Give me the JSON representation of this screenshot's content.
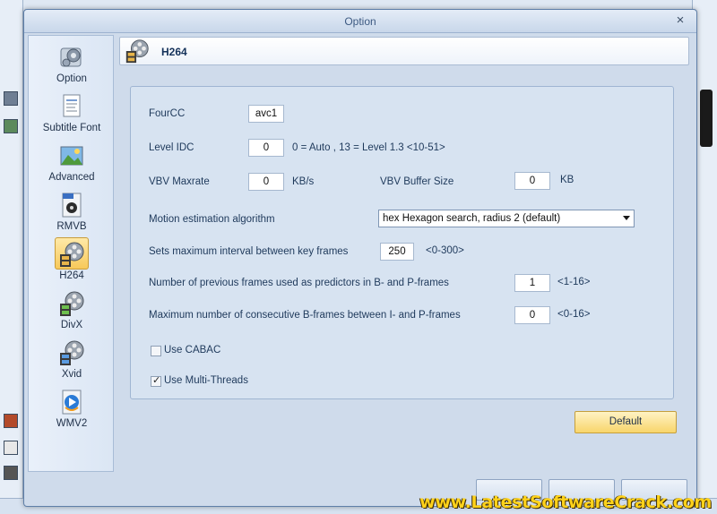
{
  "dialog": {
    "title": "Option",
    "close_glyph": "×"
  },
  "sidebar": {
    "items": [
      {
        "label": "Option",
        "icon": "gear-icon"
      },
      {
        "label": "Subtitle Font",
        "icon": "document-text-icon"
      },
      {
        "label": "Advanced",
        "icon": "picture-icon"
      },
      {
        "label": "RMVB",
        "icon": "real-media-icon"
      },
      {
        "label": "H264",
        "icon": "film-reel-icon",
        "selected": true
      },
      {
        "label": "DivX",
        "icon": "film-reel-icon"
      },
      {
        "label": "Xvid",
        "icon": "film-reel-icon"
      },
      {
        "label": "WMV2",
        "icon": "windows-media-icon"
      }
    ]
  },
  "header": {
    "title": "H264"
  },
  "form": {
    "fourcc": {
      "label": "FourCC",
      "value": "avc1"
    },
    "level_idc": {
      "label": "Level IDC",
      "value": "0",
      "hint": "0 = Auto , 13 = Level 1.3 <10-51>"
    },
    "vbv_maxrate": {
      "label": "VBV Maxrate",
      "value": "0",
      "unit": "KB/s"
    },
    "vbv_buffer": {
      "label": "VBV Buffer Size",
      "value": "0",
      "unit": "KB"
    },
    "motion": {
      "label": "Motion estimation algorithm",
      "value": "hex  Hexagon search, radius 2 (default)"
    },
    "keyframe_interval": {
      "label": "Sets maximum interval between key frames",
      "value": "250",
      "hint": "<0-300>"
    },
    "ref_frames": {
      "label": "Number of previous frames used as predictors in B- and P-frames",
      "value": "1",
      "hint": "<1-16>"
    },
    "bframes": {
      "label": "Maximum number of consecutive B-frames between I- and P-frames",
      "value": "0",
      "hint": "<0-16>"
    },
    "cabac": {
      "label": "Use CABAC",
      "checked": false
    },
    "multithreads": {
      "label": "Use Multi-Threads",
      "checked": true
    }
  },
  "buttons": {
    "default": "Default"
  },
  "watermark": "www.LatestSoftwareCrack.com",
  "colors": {
    "accent_yellow": "#f8d56b",
    "selected_item": "#f7c95a",
    "panel_bg": "#d7e3f1",
    "title_text": "#3d5a82"
  }
}
